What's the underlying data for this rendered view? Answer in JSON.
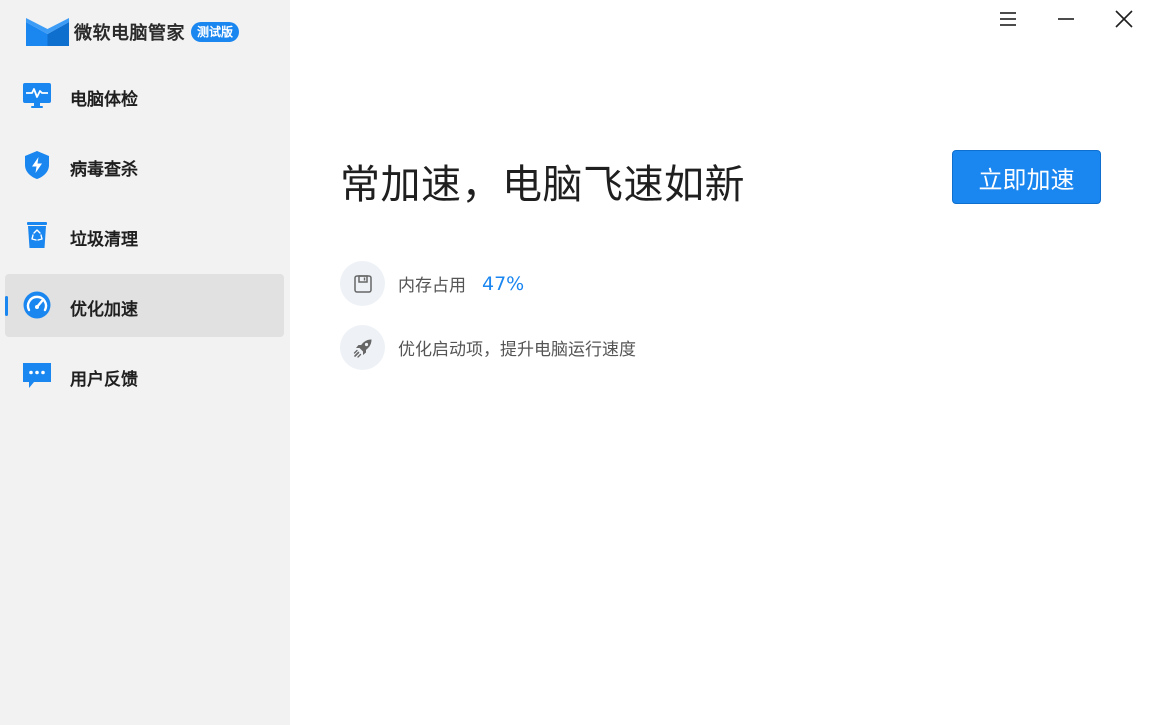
{
  "app": {
    "name": "微软电脑管家",
    "badge": "测试版"
  },
  "window_controls": {
    "menu_icon": "menu-icon",
    "minimize_icon": "minimize-icon",
    "close_icon": "close-icon"
  },
  "sidebar": {
    "items": [
      {
        "label": "电脑体检",
        "icon": "monitor-pulse-icon",
        "active": false
      },
      {
        "label": "病毒查杀",
        "icon": "shield-lightning-icon",
        "active": false
      },
      {
        "label": "垃圾清理",
        "icon": "recycle-bin-icon",
        "active": false
      },
      {
        "label": "优化加速",
        "icon": "speedometer-icon",
        "active": true
      },
      {
        "label": "用户反馈",
        "icon": "chat-bubble-icon",
        "active": false
      }
    ]
  },
  "main": {
    "headline": "常加速，电脑飞速如新",
    "action_button": "立即加速",
    "memory": {
      "label": "内存占用",
      "value": "47%",
      "icon": "memory-chip-icon"
    },
    "startup": {
      "label": "优化启动项，提升电脑运行速度",
      "icon": "rocket-icon"
    }
  },
  "colors": {
    "accent": "#1a86f0",
    "sidebar_bg": "#f2f2f2",
    "active_item_bg": "#e1e1e1"
  }
}
